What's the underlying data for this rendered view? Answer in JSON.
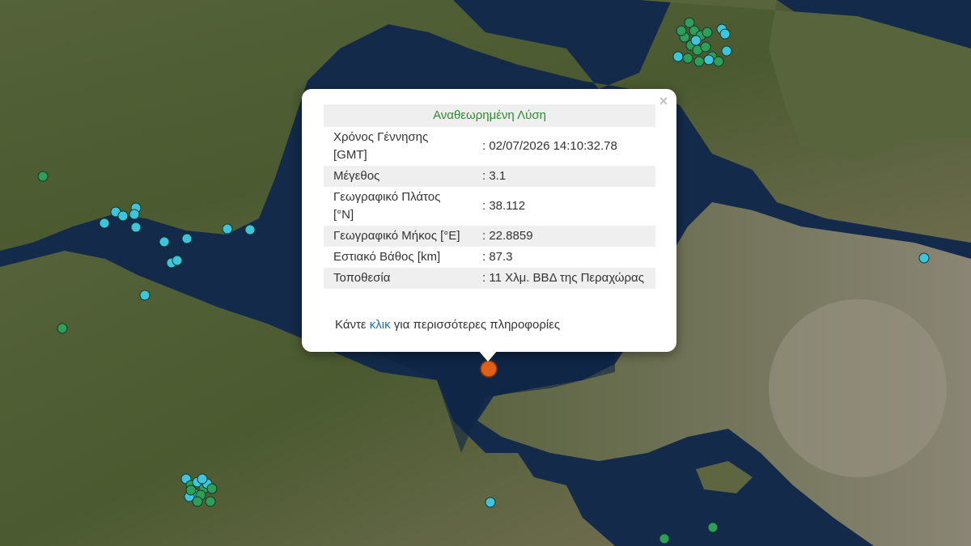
{
  "popup": {
    "title": "Αναθεωρημένη Λύση",
    "close_icon": "×",
    "rows": [
      {
        "label": "Χρόνος Γέννησης [GMT]",
        "value": ": 02/07/2026 14:10:32.78"
      },
      {
        "label": "Μέγεθος",
        "value": ": 3.1"
      },
      {
        "label": "Γεωγραφικό Πλάτος [°N]",
        "value": ": 38.112"
      },
      {
        "label": "Γεωγραφικό Μήκος [°E]",
        "value": ": 22.8859"
      },
      {
        "label": "Εστιακό Βάθος [km]",
        "value": ": 87.3"
      },
      {
        "label": "Τοποθεσία",
        "value": ": 11 Χλμ. ΒΒΔ της Περαχώρας"
      }
    ],
    "more_prefix": "Κάντε",
    "more_link": "κλικ",
    "more_suffix": "για περισσότερες πληροφορίες"
  },
  "colors": {
    "sea": "#132a4a",
    "land": "#4a5a32",
    "marker_green": "#2f9e58",
    "marker_cyan": "#3fc4dd",
    "selected_marker": "#e0601a"
  }
}
